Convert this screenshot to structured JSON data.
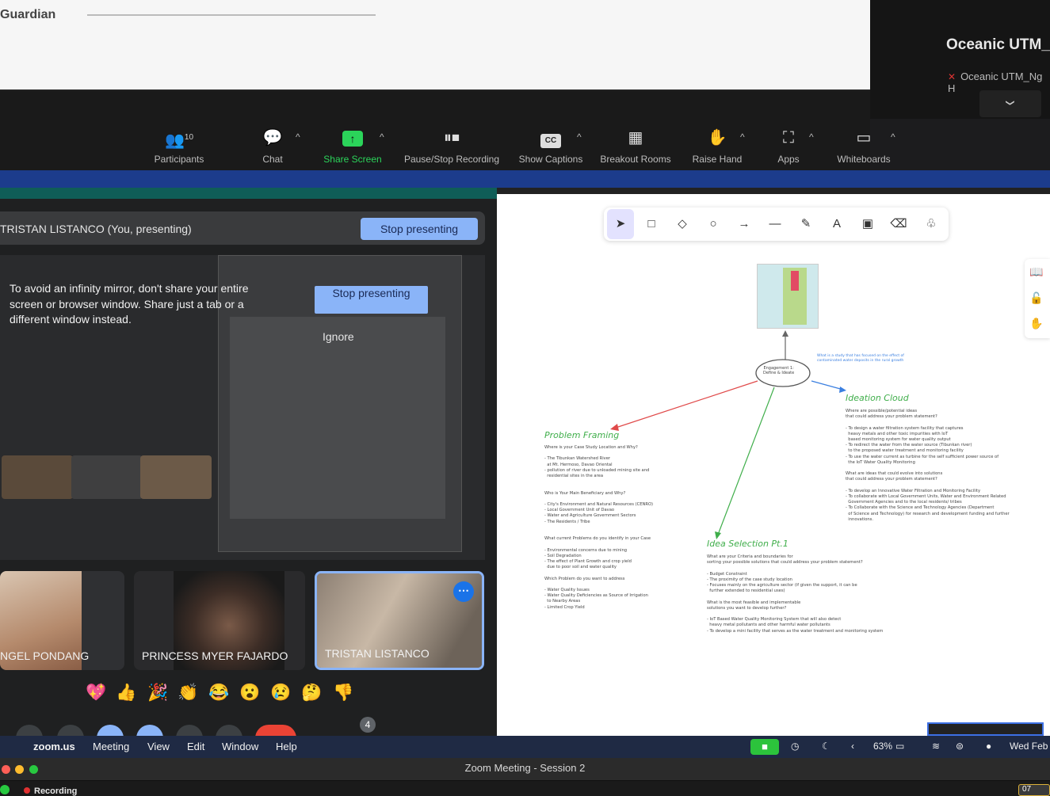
{
  "shared_top": {
    "guardian_label": "Guardian",
    "oceanic_title": "Oceanic  UTM_",
    "oceanic_sub": "Oceanic UTM_Ng H",
    "chevron_icon": "chevron-down-icon"
  },
  "zoom_toolbar": {
    "participants_count": "10",
    "items": [
      {
        "label": "Participants",
        "icon": "participants-icon"
      },
      {
        "label": "Chat",
        "icon": "chat-icon"
      },
      {
        "label": "Share Screen",
        "icon": "share-screen-icon",
        "color": "#2bd45a"
      },
      {
        "label": "Pause/Stop Recording",
        "icon": "pause-stop-icon"
      },
      {
        "label": "Show Captions",
        "icon": "cc-icon"
      },
      {
        "label": "Breakout Rooms",
        "icon": "breakout-icon"
      },
      {
        "label": "Raise Hand",
        "icon": "hand-icon"
      },
      {
        "label": "Apps",
        "icon": "apps-icon"
      },
      {
        "label": "Whiteboards",
        "icon": "whiteboard-icon"
      }
    ]
  },
  "meet": {
    "presenting_name": "TRISTAN LISTANCO (You, presenting)",
    "stop_presenting": "Stop presenting",
    "infinity_msg": "To avoid an infinity mirror, don't share your entire screen or browser window. Share just a tab or a different window instead.",
    "stop_presenting_small": "Stop presenting",
    "ignore": "Ignore",
    "tiles": [
      {
        "name": "NGEL PONDANG"
      },
      {
        "name": "PRINCESS MYER FAJARDO"
      },
      {
        "name": "TRISTAN LISTANCO"
      }
    ],
    "reactions": [
      "💖",
      "👍",
      "🎉",
      "👏",
      "😂",
      "😮",
      "😢",
      "🤔",
      "👎"
    ],
    "participant_badge": "4",
    "accent": "#8ab4f8"
  },
  "whiteboard": {
    "tools": [
      "cursor-icon",
      "rectangle-icon",
      "diamond-icon",
      "circle-icon",
      "arrow-icon",
      "line-icon",
      "pencil-icon",
      "text-icon",
      "image-icon",
      "eraser-icon",
      "library-icon"
    ],
    "tool_glyphs": [
      "➤",
      "□",
      "◇",
      "○",
      "→",
      "—",
      "✎",
      "A",
      "▣",
      "⌫",
      "♧"
    ],
    "center_node": "Engagement 1:\nDefine & Ideate",
    "note_top": "What is a study that has focused on the effect of\ncontaminated water deposits in the rural growth",
    "problem_framing": {
      "title": "Problem Framing",
      "body": "Where is your Case Study Location and Why?\n\n- The Tibunkan Watershed River\n  at Mt. Hermoso, Davao Oriental\n- pollution of river due to unloaded mining site and\n  residential sites in the area\n\n\nWho is Your Main Beneficiary and Why?\n\n- City's Environment and Natural Resources (CENRO)\n- Local Government Unit of Davao\n- Water and Agriculture Government Sectors\n- The Residents / Tribe\n\n\nWhat current Problems do you identify in your Case\n\n- Environmental concerns due to mining\n- Soil Degradation\n- The effect of Plant Growth and crop yield\n  due to poor soil and water quality\n\nWhich Problem do you want to address\n\n- Water Quality Issues\n- Water Quality Deficiencies as Source of Irrigation\n  to Nearby Areas\n- Limited Crop Yield"
    },
    "ideation_cloud": {
      "title": "Ideation Cloud",
      "body": "Where are possible/potential ideas\nthat could address your problem statement?\n\n- To design a water filtration system facility that captures\n  heavy metals and other toxic impurities with IoT\n  based monitoring system for water quality output\n- To redirect the water from the water source (Tibunkan river)\n  to the proposed water treatment and monitoring facility\n- To use the water current as turbine for the self sufficient power source of\n  the IoT Water Quality Monitoring\n\nWhat are ideas that could evolve into solutions\nthat could address your problem statement?\n\n- To develop an Innovative Water Filtration and Monitoring Facility\n- To collaborate with Local Government Units, Water and Environment Related\n  Government Agencies and to the local residents/ tribes\n- To Collaborate with the Science and Technology Agencies (Department\n  of Science and Technology) for research and development funding and further\n  innovations."
    },
    "idea_selection": {
      "title": "Idea Selection Pt.1",
      "body": "What are your Criteria and boundaries for\nsorting your possible solutions that could address your problem statement?\n\n- Budget Constraint\n- The proximity of the case study location\n- Focuses mainly on the agriculture sector (if given the support, it can be\n  further extended to residential uses)\n\nWhat is the most feasible and implementable\nsolutions you want to develop further?\n\n- IoT Based Water Quality Monitoring System that will also detect\n  heavy metal pollutants and other harmful water pollutants\n- To develop a mini facility that serves as the water treatment and monitoring system"
    }
  },
  "menubar": {
    "items": [
      "zoom.us",
      "Meeting",
      "View",
      "Edit",
      "Window",
      "Help"
    ],
    "battery": "63%",
    "date": "Wed Feb"
  },
  "window": {
    "title": "Zoom Meeting - Session 2",
    "recording": "Recording",
    "timer": "07"
  }
}
